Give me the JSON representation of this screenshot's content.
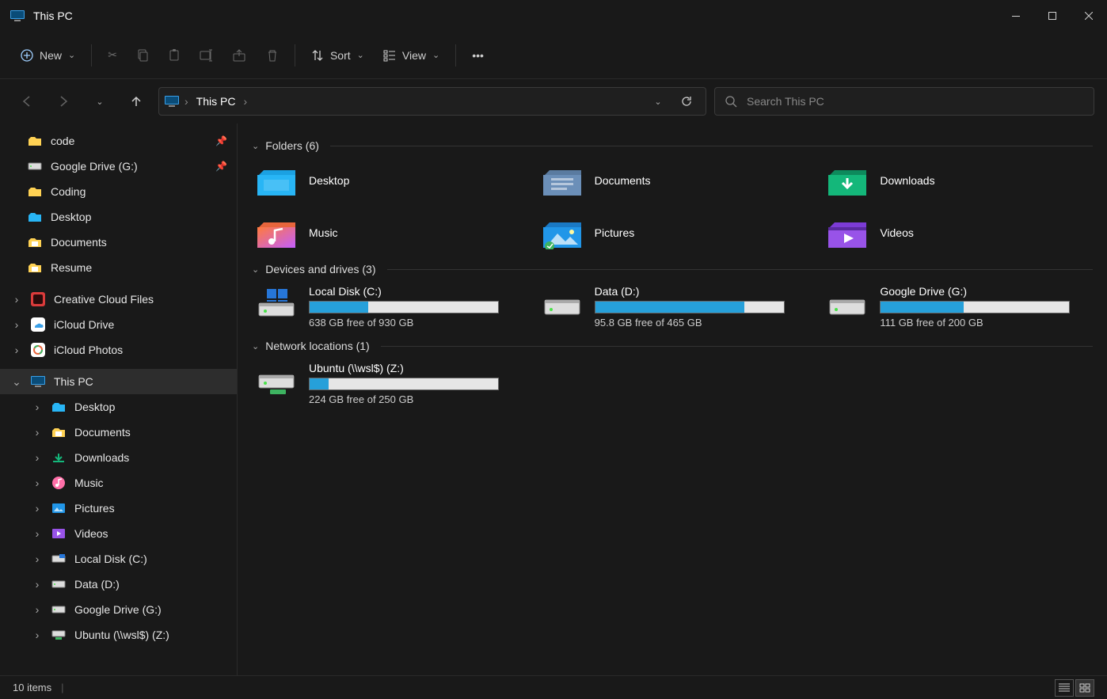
{
  "window": {
    "title": "This PC"
  },
  "toolbar": {
    "new_label": "New",
    "sort_label": "Sort",
    "view_label": "View"
  },
  "breadcrumb": {
    "current": "This PC"
  },
  "search": {
    "placeholder": "Search This PC"
  },
  "sidebar": {
    "quick": [
      {
        "label": "code",
        "icon": "folder-yellow",
        "pinned": true
      },
      {
        "label": "Google Drive (G:)",
        "icon": "drive-white",
        "pinned": true
      },
      {
        "label": "Coding",
        "icon": "folder-yellow",
        "pinned": false
      },
      {
        "label": "Desktop",
        "icon": "folder-blue",
        "pinned": false
      },
      {
        "label": "Documents",
        "icon": "folder-doc",
        "pinned": false
      },
      {
        "label": "Resume",
        "icon": "folder-doc",
        "pinned": false
      }
    ],
    "cloud": [
      {
        "label": "Creative Cloud Files",
        "icon": "cc"
      },
      {
        "label": "iCloud Drive",
        "icon": "icloud"
      },
      {
        "label": "iCloud Photos",
        "icon": "iphotos"
      }
    ],
    "thispc_label": "This PC",
    "thispc_children": [
      {
        "label": "Desktop",
        "icon": "folder-blue"
      },
      {
        "label": "Documents",
        "icon": "folder-doc"
      },
      {
        "label": "Downloads",
        "icon": "downloads"
      },
      {
        "label": "Music",
        "icon": "music"
      },
      {
        "label": "Pictures",
        "icon": "pictures"
      },
      {
        "label": "Videos",
        "icon": "videos"
      },
      {
        "label": "Local Disk (C:)",
        "icon": "drive-blue"
      },
      {
        "label": "Data (D:)",
        "icon": "drive-white"
      },
      {
        "label": "Google Drive (G:)",
        "icon": "drive-white"
      },
      {
        "label": "Ubuntu (\\\\wsl$) (Z:)",
        "icon": "drive-net"
      }
    ]
  },
  "groups": {
    "folders_header": "Folders (6)",
    "folders": [
      {
        "label": "Desktop",
        "icon": "desktop"
      },
      {
        "label": "Documents",
        "icon": "documents"
      },
      {
        "label": "Downloads",
        "icon": "downloads"
      },
      {
        "label": "Music",
        "icon": "music"
      },
      {
        "label": "Pictures",
        "icon": "pictures"
      },
      {
        "label": "Videos",
        "icon": "videos"
      }
    ],
    "drives_header": "Devices and drives (3)",
    "drives": [
      {
        "label": "Local Disk (C:)",
        "free_text": "638 GB free of 930 GB",
        "used_pct": 31,
        "icon": "disk-win"
      },
      {
        "label": "Data (D:)",
        "free_text": "95.8 GB free of 465 GB",
        "used_pct": 79,
        "icon": "disk"
      },
      {
        "label": "Google Drive (G:)",
        "free_text": "111 GB free of 200 GB",
        "used_pct": 44,
        "icon": "disk"
      }
    ],
    "network_header": "Network locations (1)",
    "network": [
      {
        "label": "Ubuntu (\\\\wsl$) (Z:)",
        "free_text": "224 GB free of 250 GB",
        "used_pct": 10,
        "icon": "disk-net"
      }
    ]
  },
  "status": {
    "items": "10 items"
  }
}
